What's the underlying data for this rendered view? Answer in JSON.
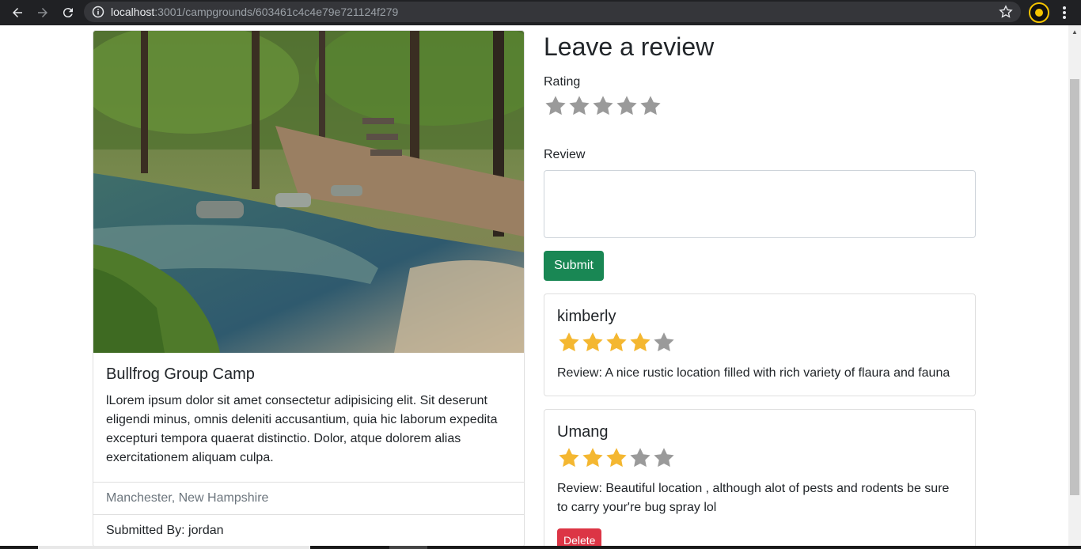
{
  "browser": {
    "url_host": "localhost",
    "url_rest": ":3001/campgrounds/603461c4c4e79e721124f279"
  },
  "campground": {
    "image_alt": "Forest creek with stones",
    "title": "Bullfrog Group Camp",
    "description": "lLorem ipsum dolor sit amet consectetur adipisicing elit. Sit deserunt eligendi minus, omnis deleniti accusantium, quia hic laborum expedita excepturi tempora quaerat distinctio. Dolor, atque dolorem alias exercitationem aliquam culpa.",
    "location": "Manchester, New Hampshire",
    "submitted_by": "Submitted By: jordan"
  },
  "review_form": {
    "heading": "Leave a review",
    "rating_label": "Rating",
    "rating_value": 0,
    "review_label": "Review",
    "review_value": "",
    "submit_label": "Submit"
  },
  "reviews": [
    {
      "author": "kimberly",
      "rating": 4,
      "text": "Review: A nice rustic location filled with rich variety of flaura and fauna"
    },
    {
      "author": "Umang",
      "rating": 3,
      "text": "Review: Beautiful location , although alot of pests and rodents be sure to carry your're bug spray lol",
      "delete_label": "Delete"
    }
  ],
  "colors": {
    "star_filled": "#f4b731",
    "star_empty": "#9a9a9a",
    "submit": "#198754",
    "delete": "#dc3545"
  }
}
